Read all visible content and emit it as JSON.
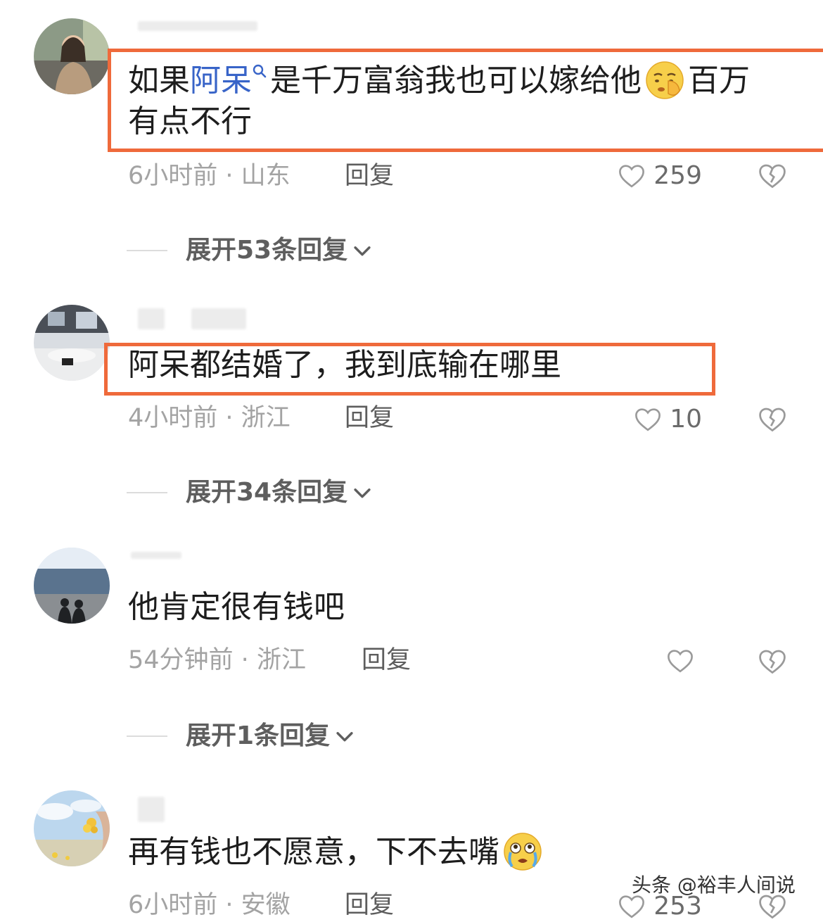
{
  "comments": [
    {
      "text_before": "如果",
      "mention": "阿呆",
      "text_after": "是千万富翁我也可以嫁给他",
      "text_tail": "百万",
      "text_line2": "有点不行",
      "time": "6小时前",
      "location": "山东",
      "reply_label": "回复",
      "likes": "259",
      "expand_label": "展开53条回复"
    },
    {
      "text": "阿呆都结婚了，我到底输在哪里",
      "time": "4小时前",
      "location": "浙江",
      "reply_label": "回复",
      "likes": "10",
      "expand_label": "展开34条回复"
    },
    {
      "text": "他肯定很有钱吧",
      "time": "54分钟前",
      "location": "浙江",
      "reply_label": "回复",
      "likes": "",
      "expand_label": "展开1条回复"
    },
    {
      "text": "再有钱也不愿意，下不去嘴",
      "time": "6小时前",
      "location": "安徽",
      "reply_label": "回复",
      "likes": "253"
    }
  ],
  "separator": " · ",
  "watermark": "头条 @裕丰人间说",
  "colors": {
    "highlight": "#ef6a3b",
    "mention": "#3864c8"
  },
  "icons": {
    "like": "heart-outline-icon",
    "dislike": "broken-heart-icon",
    "expand": "chevron-down-icon",
    "mention_search": "search-icon"
  }
}
